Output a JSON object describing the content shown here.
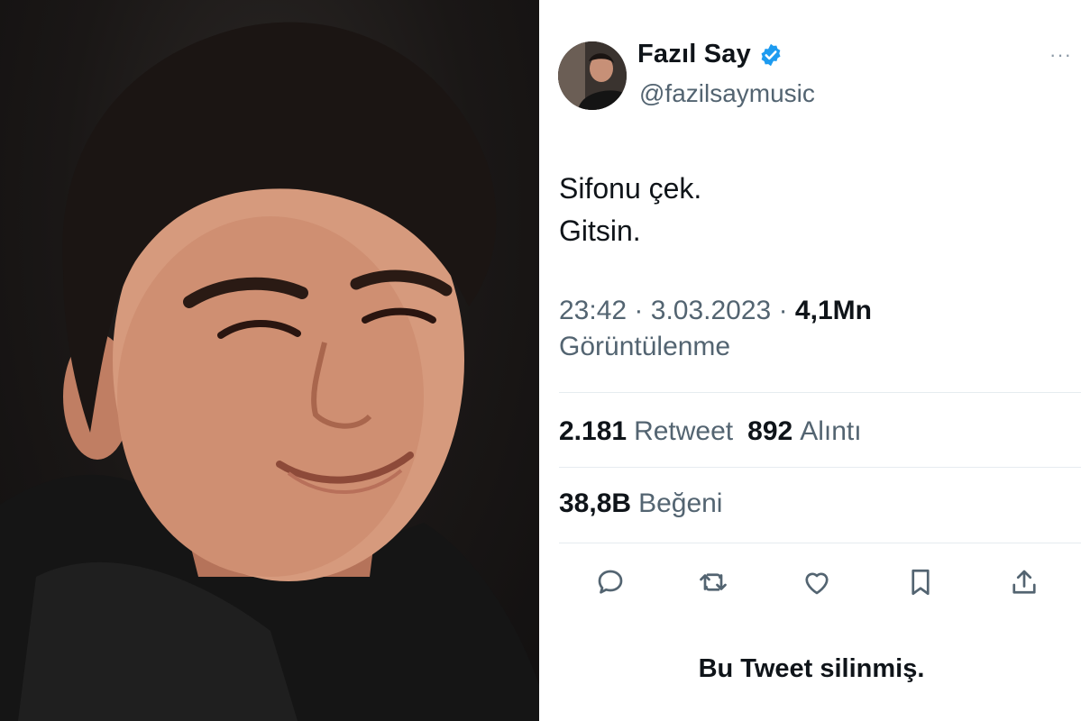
{
  "tweet": {
    "display_name": "Fazıl Say",
    "handle": "@fazilsaymusic",
    "text_line1": "Sifonu çek.",
    "text_line2": "Gitsin.",
    "time": "23:42",
    "date": "3.03.2023",
    "separator": "·",
    "views_count": "4,1Mn",
    "views_label": "Görüntülenme",
    "retweets_count": "2.181",
    "retweets_label": "Retweet",
    "quotes_count": "892",
    "quotes_label": "Alıntı",
    "likes_count": "38,8B",
    "likes_label": "Beğeni",
    "deleted_notice": "Bu Tweet silinmiş."
  },
  "colors": {
    "verified_blue": "#1d9bf0",
    "muted_text": "#536471",
    "primary_text": "#0f1419"
  },
  "icons": [
    "verified-badge-icon",
    "more-icon",
    "reply-icon",
    "retweet-icon",
    "like-icon",
    "bookmark-icon",
    "share-icon"
  ]
}
